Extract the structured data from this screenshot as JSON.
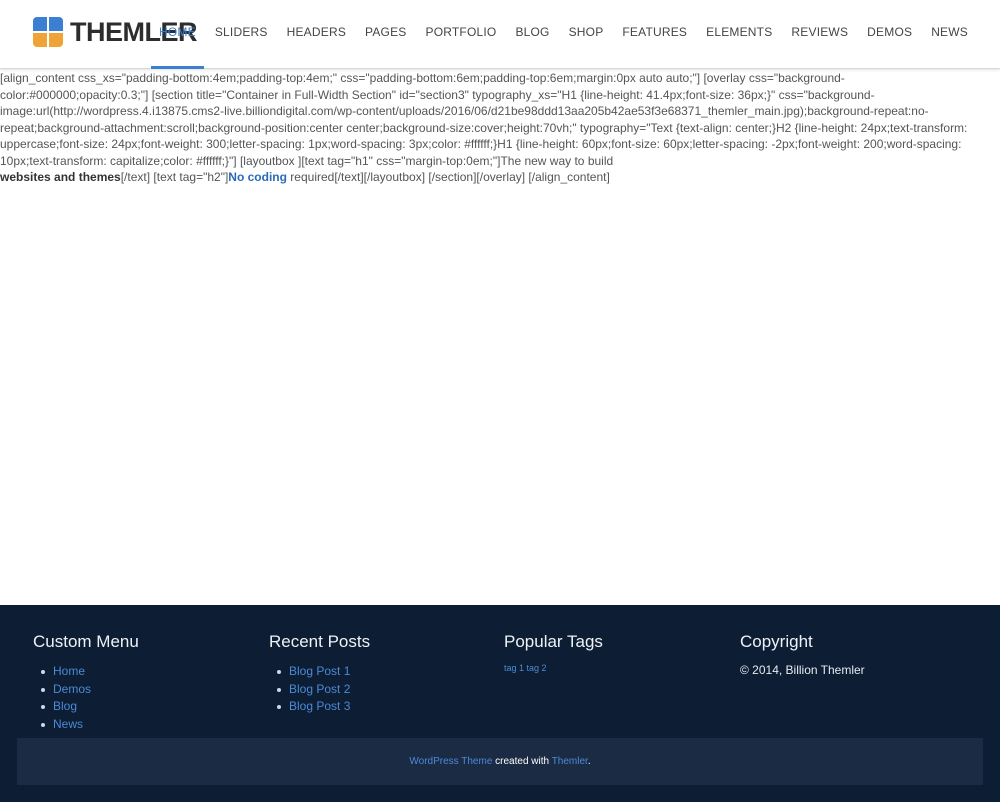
{
  "header": {
    "logo_text": "THEMLER",
    "nav": [
      "HOME",
      "SLIDERS",
      "HEADERS",
      "PAGES",
      "PORTFOLIO",
      "BLOG",
      "SHOP",
      "FEATURES",
      "ELEMENTS",
      "REVIEWS",
      "DEMOS",
      "NEWS"
    ]
  },
  "content": {
    "shortcode_text": "[align_content css_xs=\"padding-bottom:4em;padding-top:4em;\" css=\"padding-bottom:6em;padding-top:6em;margin:0px auto auto;\"] [overlay css=\"background-color:#000000;opacity:0.3;\"] [section title=\"Container in Full-Width Section\" id=\"section3\" typography_xs=\"H1 {line-height: 41.4px;font-size: 36px;}\" css=\"background-image:url(http://wordpress.4.i13875.cms2-live.billiondigital.com/wp-content/uploads/2016/06/d21be98ddd13aa205b42ae53f3e68371_themler_main.jpg);background-repeat:no-repeat;background-attachment:scroll;background-position:center center;background-size:cover;height:70vh;\" typography=\"Text {text-align: center;}H2 {line-height: 24px;text-transform: uppercase;font-size: 24px;font-weight: 300;letter-spacing: 1px;word-spacing: 3px;color: #ffffff;}H1 {line-height: 60px;font-size: 60px;letter-spacing: -2px;font-weight: 200;word-spacing: 10px;text-transform: capitalize;color: #ffffff;}\"] [layoutbox ][text tag=\"h1\" css=\"margin-top:0em;\"]The new way to build",
    "bold_text": "websites and themes",
    "mid_text": "[/text] [text tag=\"h2\"]",
    "link_text": "No coding",
    "end_text": " required[/text][/layoutbox] [/section][/overlay] [/align_content]"
  },
  "footer": {
    "custom_menu": {
      "title": "Custom Menu",
      "items": [
        "Home",
        "Demos",
        "Blog",
        "News"
      ]
    },
    "recent_posts": {
      "title": "Recent Posts",
      "items": [
        "Blog Post 1",
        "Blog Post 2",
        "Blog Post 3"
      ]
    },
    "popular_tags": {
      "title": "Popular Tags",
      "tags": [
        "tag 1",
        "tag 2"
      ]
    },
    "copyright": {
      "title": "Copyright",
      "text": "© 2014, Billion Themler"
    },
    "bottom": {
      "link1": "WordPress Theme",
      "middle": " created with ",
      "link2": "Themler",
      "end": "."
    }
  },
  "colors": {
    "accent": "#3b7fd0",
    "footer_bg": "#0d1d33",
    "bottom_bar_bg": "#1c2b44"
  }
}
